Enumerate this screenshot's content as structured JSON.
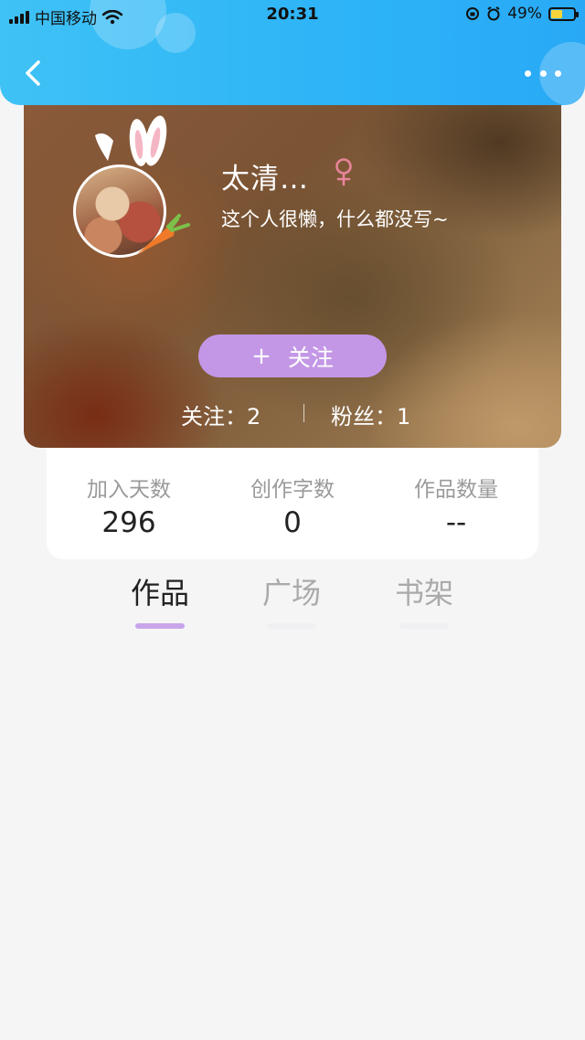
{
  "status_bar": {
    "carrier": "中国移动",
    "time": "20:31",
    "battery": "49%",
    "battery_level": 0.49
  },
  "header": {
    "back_icon": "chevron-left-icon",
    "more_icon": "more-dots-icon"
  },
  "profile": {
    "nickname": "太清…",
    "gender_symbol": "♀",
    "gender_color": "#e8849a",
    "bio": "这个人很懒，什么都没写~",
    "follow_button": {
      "plus": "+",
      "label": "关注",
      "color": "#c397e6"
    },
    "following": "关注：2",
    "fans": "粉丝：1"
  },
  "stats": [
    {
      "label": "加入天数",
      "value": "296"
    },
    {
      "label": "创作字数",
      "value": "0"
    },
    {
      "label": "作品数量",
      "value": "--"
    }
  ],
  "tabs": [
    {
      "label": "作品",
      "active": true
    },
    {
      "label": "广场",
      "active": false
    },
    {
      "label": "书架",
      "active": false
    }
  ],
  "colors": {
    "header_blue": "#2db3f7",
    "tab_indicator": "#c9a5ea",
    "page_background": "#f5f5f6"
  }
}
